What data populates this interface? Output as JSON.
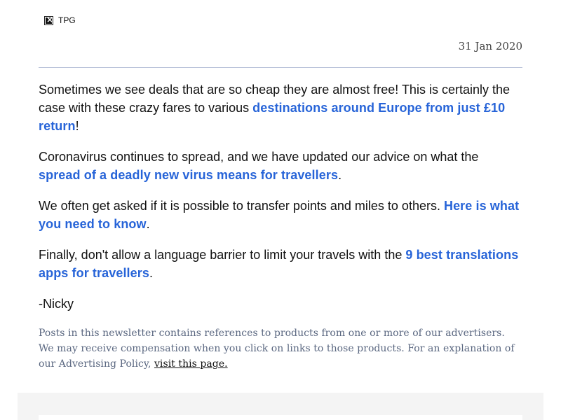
{
  "header": {
    "logo_alt": "TPG",
    "date": "31 Jan 2020"
  },
  "content": {
    "p1_before": "Sometimes we see deals that are so cheap they are almost free! This is certainly the case with these crazy fares to various ",
    "p1_link": "destinations around Europe from just £10 return",
    "p1_after": "!",
    "p2_before": "Coronavirus continues to spread, and we have updated our advice on what the ",
    "p2_link": "spread of a deadly new virus means for travellers",
    "p2_after": ".",
    "p3_before": "We often get asked if it is possible to transfer points and miles to others. ",
    "p3_link": "Here is what you need to know",
    "p3_after": ".",
    "p4_before": "Finally, don't allow a language barrier to limit your travels with the ",
    "p4_link": "9 best translations apps for travellers",
    "p4_after": ".",
    "signoff": "-Nicky"
  },
  "disclaimer": {
    "text": "Posts in this newsletter contains references to products from one or more of our advertisers. We may receive compensation when you click on links to those products. For an explanation of our Advertising Policy, ",
    "link": "visit this page."
  },
  "colors": {
    "link": "#2764d8",
    "body_text": "#111111",
    "muted_text": "#5a6780",
    "divider": "#b7c1d8",
    "footer_band": "#f4f4f4"
  },
  "icons": {
    "logo": "broken-image-icon"
  }
}
